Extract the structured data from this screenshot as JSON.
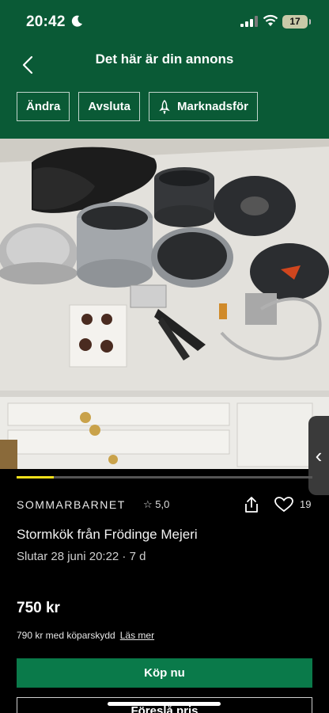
{
  "status_bar": {
    "time": "20:42",
    "battery": "17"
  },
  "header": {
    "title": "Det här är din annons",
    "buttons": {
      "edit": "Ändra",
      "end": "Avsluta",
      "promote": "Marknadsför"
    }
  },
  "gallery": {
    "progress": 0.125
  },
  "listing": {
    "seller": "SOMMARBARNET",
    "rating": "5,0",
    "likes": "19",
    "title": "Stormkök från Frödinge Mejeri",
    "ends": "Slutar 28 juni 20:22 · 7 d",
    "price": "750 kr",
    "buyer_protection": "790 kr med köparskydd",
    "read_more": "Läs mer"
  },
  "actions": {
    "buy_now": "Köp nu",
    "suggest_price": "Föreslå pris"
  },
  "colors": {
    "brand_green": "#0a5a36",
    "button_green": "#0a7a4a",
    "accent_yellow": "#f5e11b"
  }
}
